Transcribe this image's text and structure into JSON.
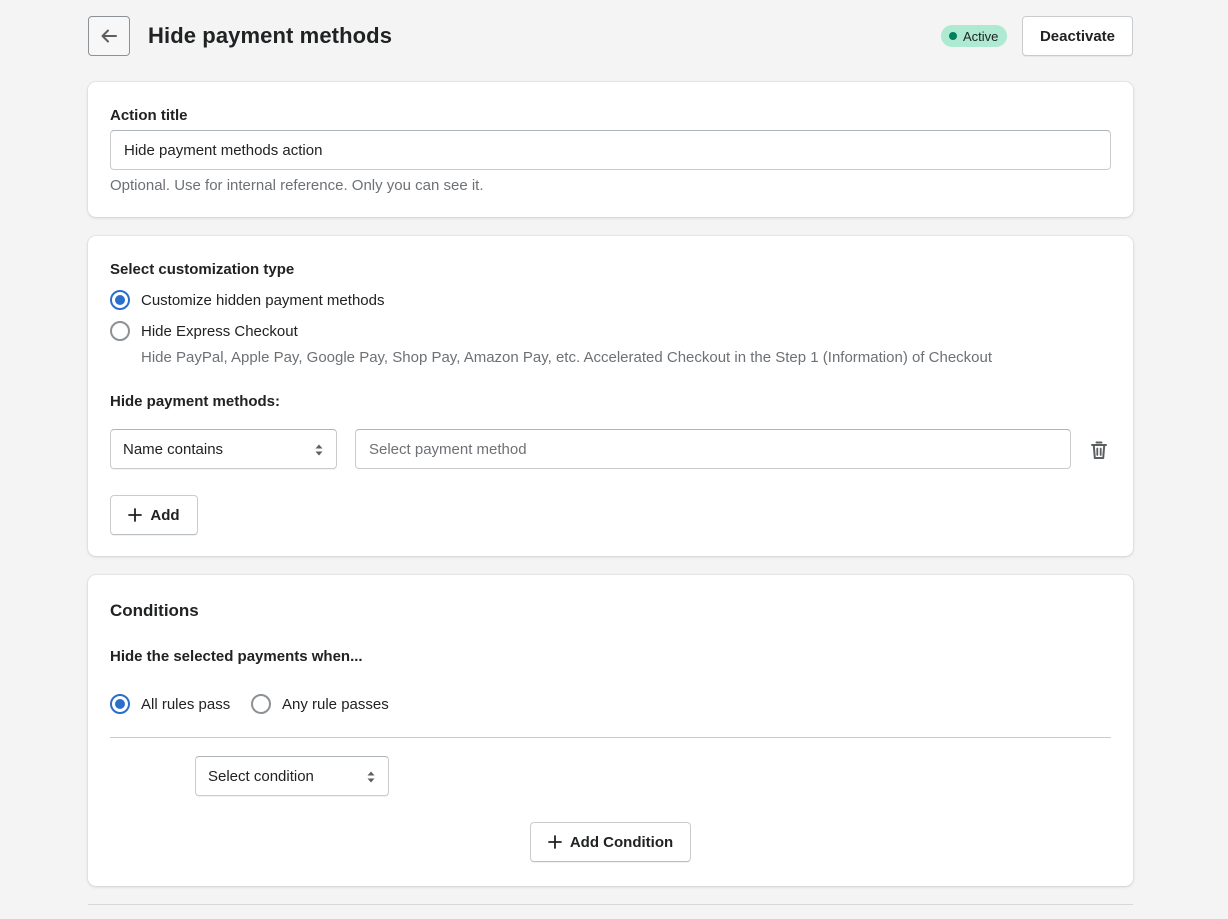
{
  "header": {
    "title": "Hide payment methods",
    "back_icon": "arrow-left-icon",
    "status_badge": "Active",
    "deactivate_label": "Deactivate"
  },
  "action_title_card": {
    "label": "Action title",
    "input_value": "Hide payment methods action",
    "help_text": "Optional. Use for internal reference. Only you can see it."
  },
  "customization_card": {
    "type_label": "Select customization type",
    "options": [
      {
        "label": "Customize hidden payment methods",
        "checked": true
      },
      {
        "label": "Hide Express Checkout",
        "checked": false
      }
    ],
    "express_help": "Hide PayPal, Apple Pay, Google Pay, Shop Pay, Amazon Pay, etc. Accelerated Checkout in the Step 1 (Information) of Checkout",
    "methods_label": "Hide payment methods:",
    "match_select_value": "Name contains",
    "payment_method_placeholder": "Select payment method",
    "add_label": "Add"
  },
  "conditions_card": {
    "title": "Conditions",
    "subtitle": "Hide the selected payments when...",
    "rule_options": [
      {
        "label": "All rules pass",
        "checked": true
      },
      {
        "label": "Any rule passes",
        "checked": false
      }
    ],
    "condition_select_value": "Select condition",
    "add_condition_label": "Add Condition"
  },
  "colors": {
    "accent": "#2c6ecb",
    "badge_bg": "#aee9d1",
    "badge_dot": "#007f5f",
    "page_bg": "#f4f4f4"
  }
}
